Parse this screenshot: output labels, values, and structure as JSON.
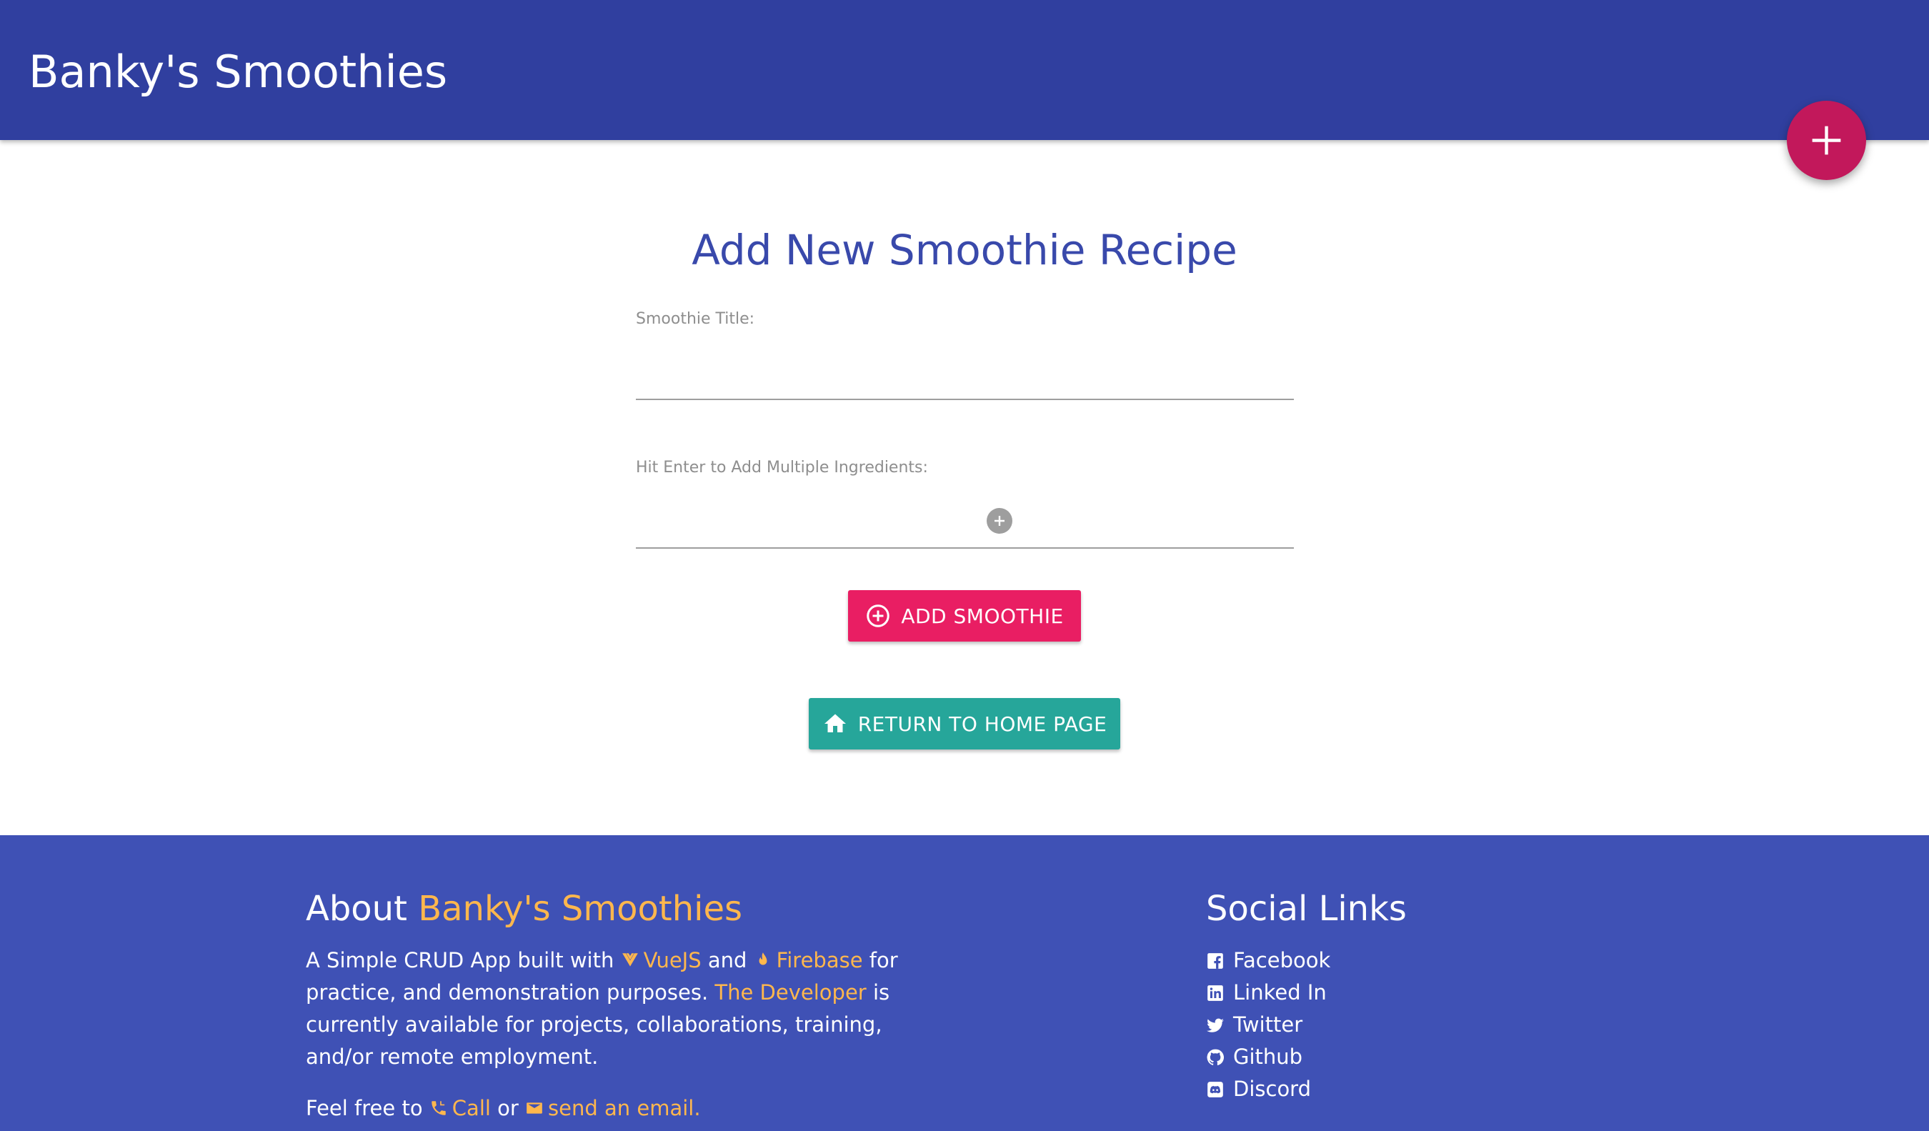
{
  "navbar": {
    "brand": "Banky's Smoothies",
    "fab_icon": "plus-icon"
  },
  "form": {
    "title": "Add New Smoothie Recipe",
    "title_label": "Smoothie Title:",
    "title_value": "",
    "ingredients_label": "Hit Enter to Add Multiple Ingredients:",
    "ingredients_value": "",
    "add_ingredient_icon": "plus-circle-icon",
    "add_button_label": "ADD SMOOTHIE",
    "add_button_icon": "plus-circle-outline-icon",
    "home_button_label": "RETURN TO HOME PAGE",
    "home_button_icon": "home-icon"
  },
  "footer": {
    "about_heading_prefix": "About",
    "about_heading_brand": "Banky's Smoothies",
    "about_p1_a": "A Simple CRUD App built with",
    "vue_label": "VueJS",
    "about_p1_b": "and",
    "firebase_label": "Firebase",
    "about_p1_c": "for practice, and demonstration purposes.",
    "developer_label": "The Developer",
    "about_p1_d": "is currently available for projects, collaborations, training, and/or remote employment.",
    "about_p2_a": "Feel free to",
    "call_label": "Call",
    "about_p2_b": "or",
    "email_label": "send an email.",
    "social_heading": "Social Links",
    "social_links": [
      {
        "label": "Facebook",
        "icon": "facebook-icon"
      },
      {
        "label": "Linked In",
        "icon": "linkedin-icon"
      },
      {
        "label": "Twitter",
        "icon": "twitter-icon"
      },
      {
        "label": "Github",
        "icon": "github-icon"
      },
      {
        "label": "Discord",
        "icon": "discord-icon"
      }
    ]
  },
  "colors": {
    "navbar": "#303f9f",
    "fab": "#c2185b",
    "title": "#3949ab",
    "add_button": "#e91e63",
    "home_button": "#26a69a",
    "footer": "#3f51b5",
    "accent_link": "#ffb74d"
  }
}
